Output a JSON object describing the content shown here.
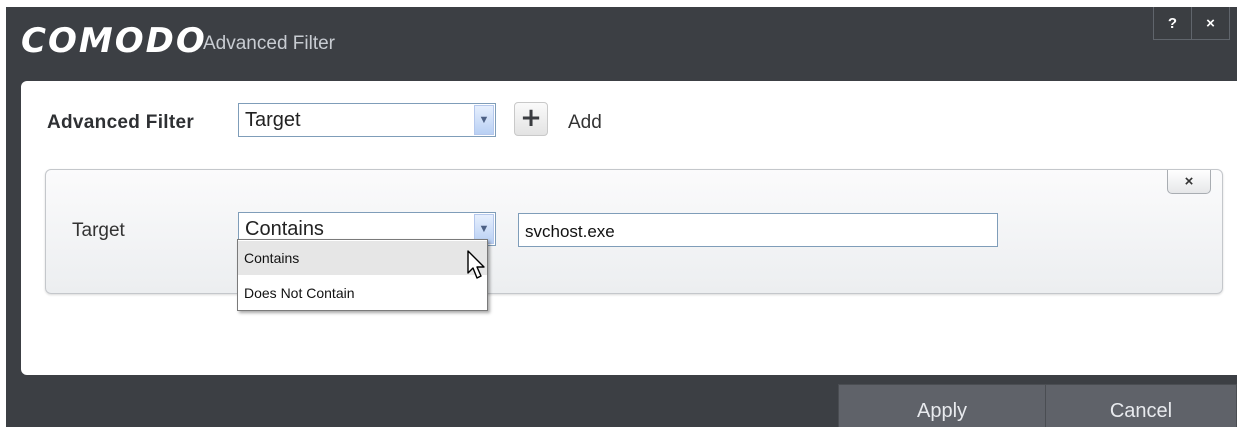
{
  "window": {
    "brand": "COMODO",
    "title": "Advanced Filter",
    "help_label": "?",
    "close_label": "×"
  },
  "filter_bar": {
    "label": "Advanced Filter",
    "selected": "Target",
    "add_label": "Add",
    "add_symbol": "+"
  },
  "filter_row": {
    "field_label": "Target",
    "condition": "Contains",
    "value": "svchost.exe",
    "remove_label": "×"
  },
  "dropdown": {
    "options": [
      "Contains",
      "Does Not Contain"
    ],
    "hovered_index": 0
  },
  "footer": {
    "apply_label": "Apply",
    "cancel_label": "Cancel"
  },
  "colors": {
    "title_bar": "#3c3f44",
    "footer_button": "#5f6269",
    "content_bg": "#ffffff"
  }
}
